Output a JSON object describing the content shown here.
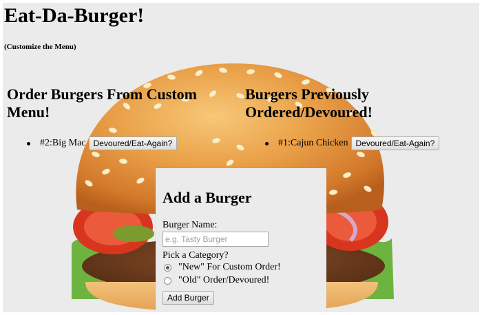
{
  "header": {
    "title": "Eat-Da-Burger!",
    "subtitle": "(Customize the Menu)"
  },
  "left_column": {
    "heading": "Order Burgers From Custom Menu!",
    "items": [
      {
        "label": "#2:Big Mac",
        "button_label": "Devoured/Eat-Again?"
      }
    ]
  },
  "right_column": {
    "heading": "Burgers Previously Ordered/Devoured!",
    "items": [
      {
        "label": "#1:Cajun Chicken",
        "button_label": "Devoured/Eat-Again?"
      }
    ]
  },
  "form": {
    "title": "Add a Burger",
    "name_label": "Burger Name:",
    "name_placeholder": "e.g. Tasty Burger",
    "name_value": "",
    "category_label": "Pick a Category?",
    "options": [
      {
        "label": "\"New\" For Custom Order!",
        "checked": true
      },
      {
        "label": "\"Old\" Order/Devoured!",
        "checked": false
      }
    ],
    "submit_label": "Add Burger"
  },
  "colors": {
    "page_background": "#ebebeb",
    "bun": "#e89a3c",
    "tomato": "#d8351f",
    "lettuce": "#6cb33f",
    "patty": "#6b3a1e"
  }
}
